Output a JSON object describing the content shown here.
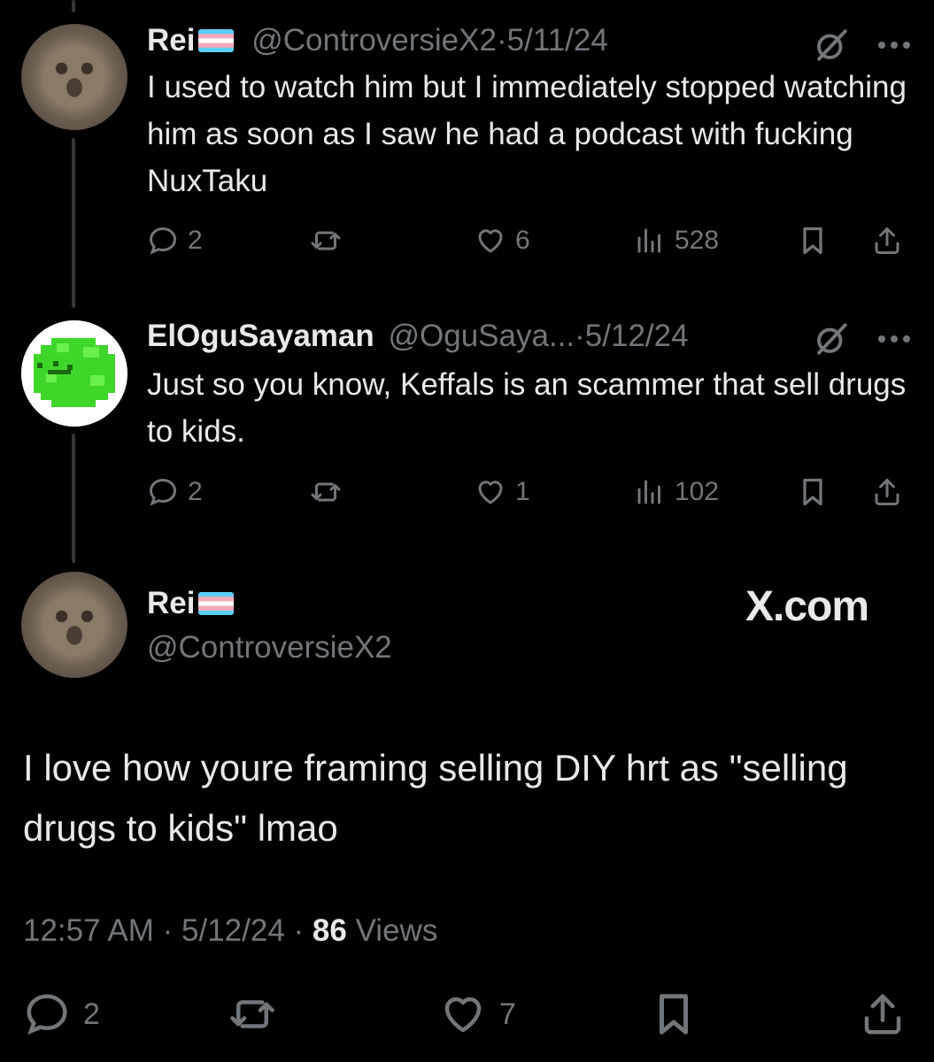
{
  "colors": {
    "background": "#000000",
    "text": "#e7e9ea",
    "muted": "#71767b",
    "thread_line": "#333639"
  },
  "replies": [
    {
      "name": "Rei",
      "handle": "@ControversieX2",
      "date": "5/11/24",
      "text": "I used to watch him but I immediately stopped watching him as soon as I saw he had a podcast with fucking NuxTaku",
      "replies_count": "2",
      "likes": "6",
      "views": "528"
    },
    {
      "name": "ElOguSayaman",
      "handle": "@OguSaya...",
      "date": "5/12/24",
      "text": "Just so you know, Keffals is an scammer that sell drugs to kids.",
      "replies_count": "2",
      "likes": "1",
      "views": "102"
    }
  ],
  "main": {
    "name": "Rei",
    "handle": "@ControversieX2",
    "watermark": "X.com",
    "text": "I love how youre framing selling DIY hrt as \"selling drugs to kids\" lmao",
    "time": "12:57 AM",
    "date": "5/12/24",
    "views_count": "86",
    "views_label": "Views",
    "replies_count": "2",
    "likes": "7"
  },
  "separator": "·",
  "icons": [
    "reply-icon",
    "retweet-icon",
    "like-icon",
    "views-icon",
    "bookmark-icon",
    "share-icon",
    "grok-icon",
    "more-icon",
    "trans-flag-icon"
  ]
}
